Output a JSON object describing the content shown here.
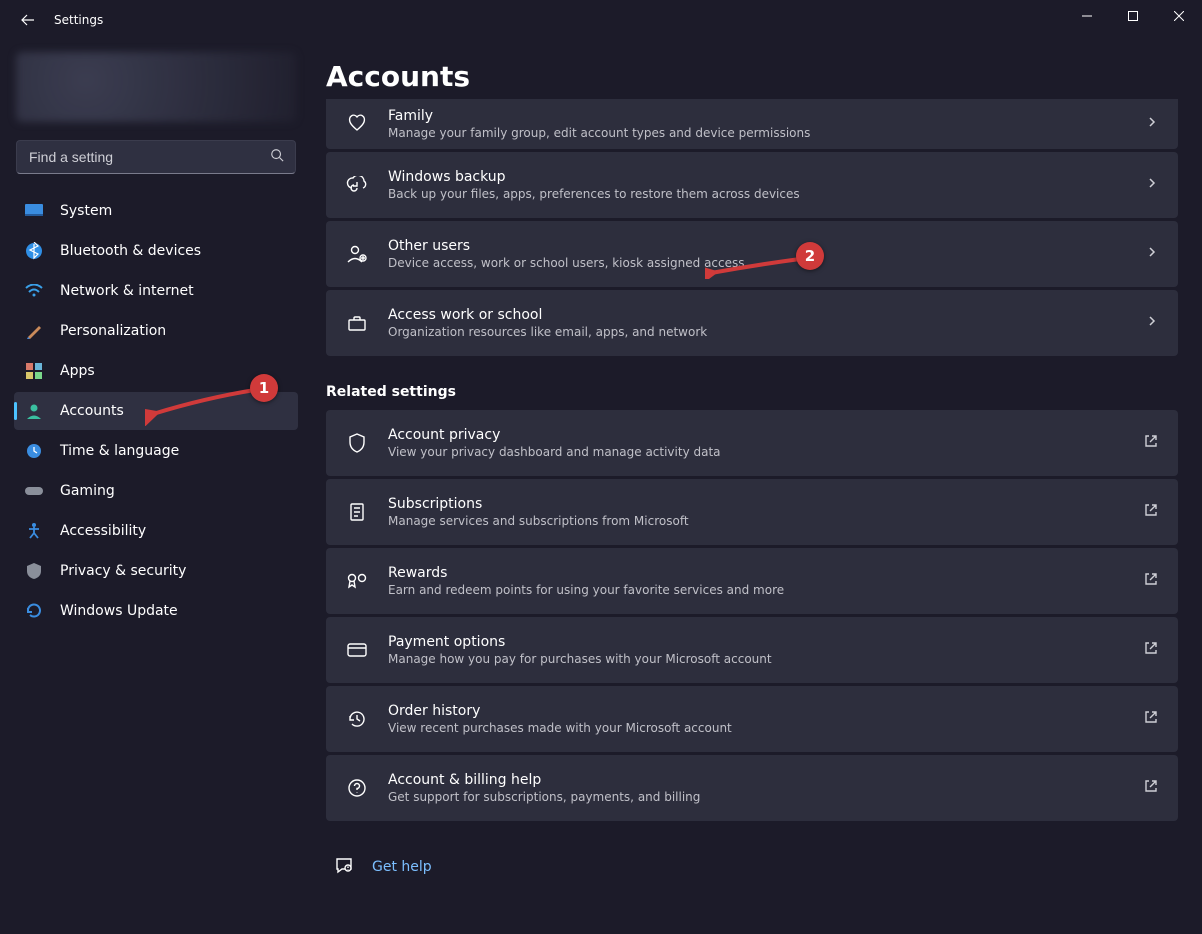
{
  "window": {
    "title": "Settings"
  },
  "search": {
    "placeholder": "Find a setting"
  },
  "sidebar": {
    "items": [
      {
        "label": "System"
      },
      {
        "label": "Bluetooth & devices"
      },
      {
        "label": "Network & internet"
      },
      {
        "label": "Personalization"
      },
      {
        "label": "Apps"
      },
      {
        "label": "Accounts"
      },
      {
        "label": "Time & language"
      },
      {
        "label": "Gaming"
      },
      {
        "label": "Accessibility"
      },
      {
        "label": "Privacy & security"
      },
      {
        "label": "Windows Update"
      }
    ],
    "activeIndex": 5
  },
  "page": {
    "title": "Accounts",
    "groups": [
      {
        "heading": null,
        "items": [
          {
            "title": "Family",
            "subtitle": "Manage your family group, edit account types and device permissions",
            "action": "chevron"
          },
          {
            "title": "Windows backup",
            "subtitle": "Back up your files, apps, preferences to restore them across devices",
            "action": "chevron"
          },
          {
            "title": "Other users",
            "subtitle": "Device access, work or school users, kiosk assigned access",
            "action": "chevron"
          },
          {
            "title": "Access work or school",
            "subtitle": "Organization resources like email, apps, and network",
            "action": "chevron"
          }
        ]
      },
      {
        "heading": "Related settings",
        "items": [
          {
            "title": "Account privacy",
            "subtitle": "View your privacy dashboard and manage activity data",
            "action": "external"
          },
          {
            "title": "Subscriptions",
            "subtitle": "Manage services and subscriptions from Microsoft",
            "action": "external"
          },
          {
            "title": "Rewards",
            "subtitle": "Earn and redeem points for using your favorite services and more",
            "action": "external"
          },
          {
            "title": "Payment options",
            "subtitle": "Manage how you pay for purchases with your Microsoft account",
            "action": "external"
          },
          {
            "title": "Order history",
            "subtitle": "View recent purchases made with your Microsoft account",
            "action": "external"
          },
          {
            "title": "Account & billing help",
            "subtitle": "Get support for subscriptions, payments, and billing",
            "action": "external"
          }
        ]
      }
    ],
    "help": {
      "label": "Get help"
    }
  },
  "annotations": {
    "marker1": "1",
    "marker2": "2"
  }
}
